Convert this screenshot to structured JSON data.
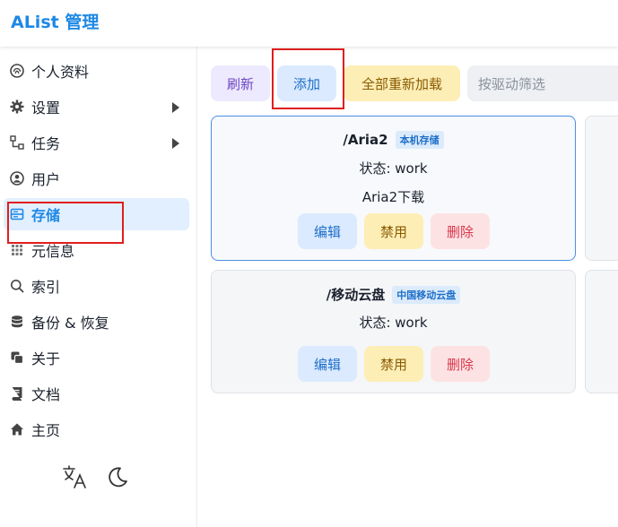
{
  "header": {
    "brand": "AList 管理"
  },
  "sidebar": {
    "items": [
      {
        "label": "个人资料",
        "icon": "user-fingerprint-icon"
      },
      {
        "label": "设置",
        "icon": "gear-icon",
        "expandable": true
      },
      {
        "label": "任务",
        "icon": "tasks-icon",
        "expandable": true
      },
      {
        "label": "用户",
        "icon": "user-circle-icon"
      },
      {
        "label": "存储",
        "icon": "storage-icon",
        "active": true
      },
      {
        "label": "元信息",
        "icon": "meta-icon"
      },
      {
        "label": "索引",
        "icon": "search-icon"
      },
      {
        "label": "备份 & 恢复",
        "icon": "database-icon"
      },
      {
        "label": "关于",
        "icon": "copy-icon"
      },
      {
        "label": "文档",
        "icon": "book-icon"
      },
      {
        "label": "主页",
        "icon": "home-icon"
      }
    ],
    "footer": {
      "translate_icon": "translate-icon",
      "theme_icon": "moon-icon"
    }
  },
  "toolbar": {
    "refresh_label": "刷新",
    "add_label": "添加",
    "reload_all_label": "全部重新加载",
    "filter_placeholder": "按驱动筛选"
  },
  "storages": [
    {
      "mount_path": "/Aria2",
      "driver": "本机存储",
      "status": "状态: work",
      "remark": "Aria2下载",
      "edit_label": "编辑",
      "disable_label": "禁用",
      "delete_label": "删除"
    },
    {
      "mount_path": "/移动云盘",
      "driver": "中国移动云盘",
      "status": "状态: work",
      "edit_label": "编辑",
      "disable_label": "禁用",
      "delete_label": "删除"
    }
  ],
  "colors": {
    "accent": "#1e88e5",
    "highlight": "#e01e1e"
  }
}
